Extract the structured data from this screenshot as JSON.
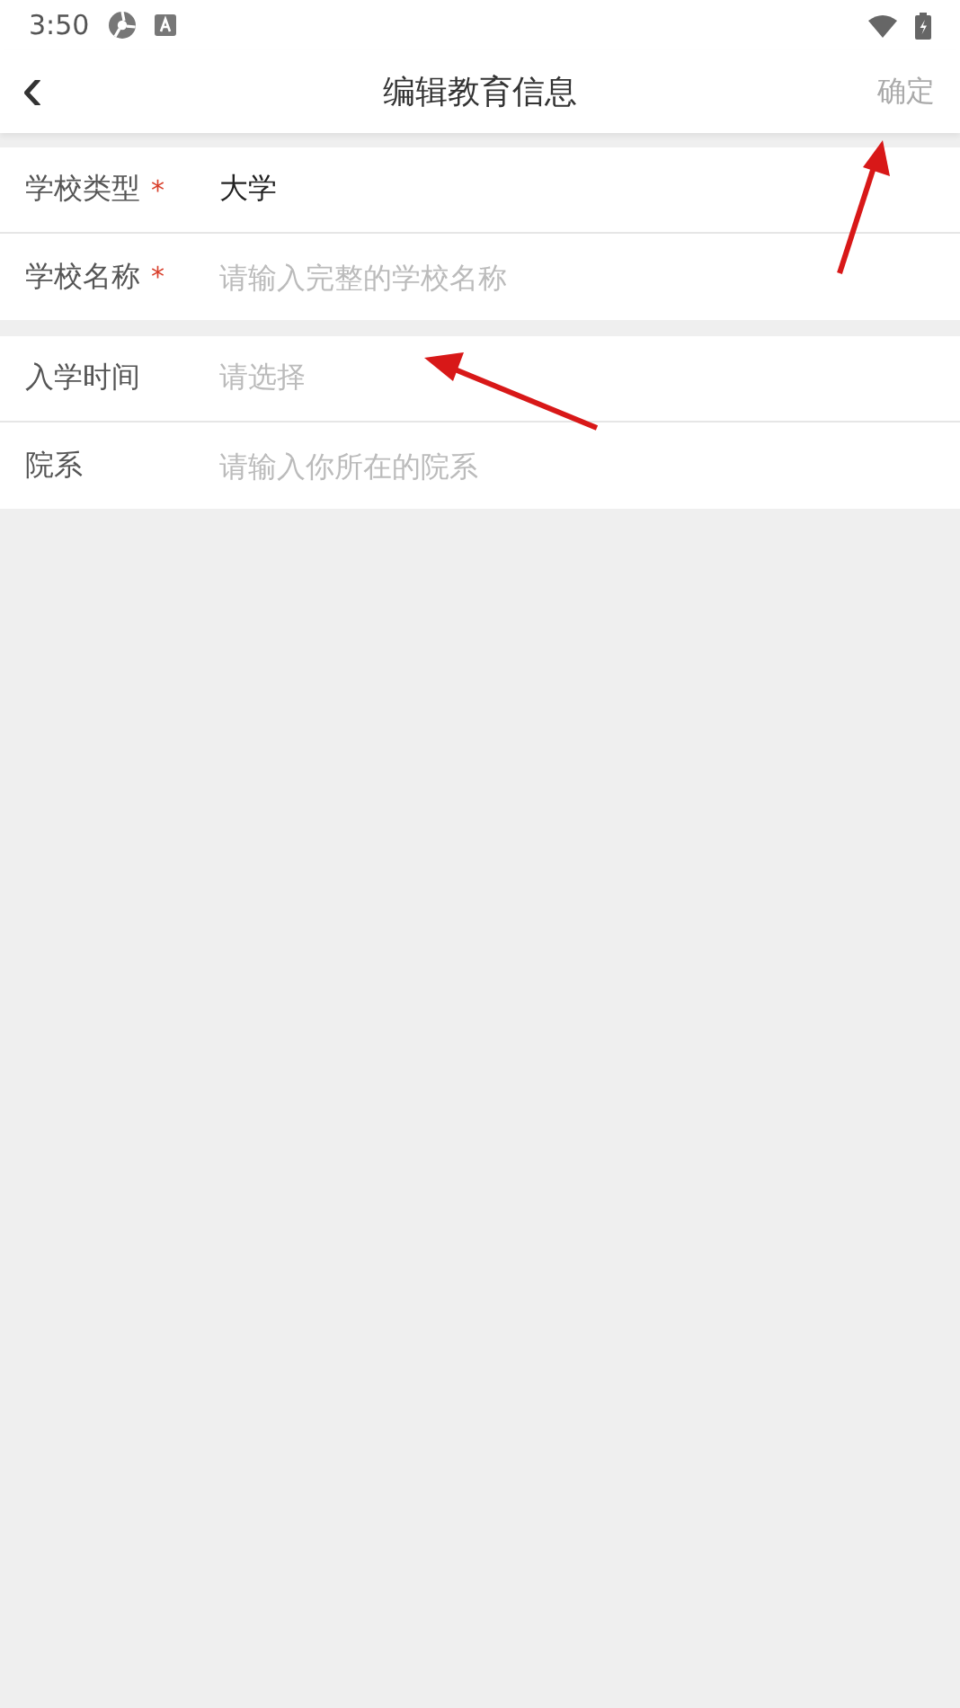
{
  "status_bar": {
    "time": "3:50"
  },
  "header": {
    "back": "‹",
    "title": "编辑教育信息",
    "action": "确定"
  },
  "sections": [
    {
      "rows": [
        {
          "kind": "select",
          "label": "学校类型",
          "required_mark": "*",
          "value": "大学"
        },
        {
          "kind": "input",
          "label": "学校名称",
          "required_mark": "*",
          "placeholder": "请输入完整的学校名称"
        }
      ]
    },
    {
      "rows": [
        {
          "kind": "select",
          "label": "入学时间",
          "placeholder": "请选择"
        },
        {
          "kind": "input",
          "label": "院系",
          "placeholder": "请输入你所在的院系"
        }
      ]
    }
  ]
}
